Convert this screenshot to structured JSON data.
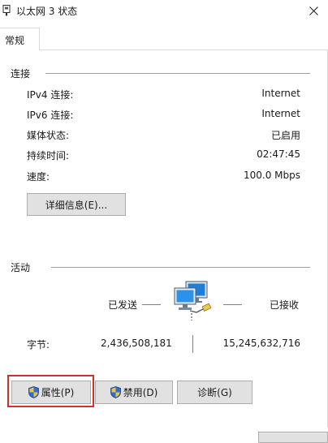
{
  "window": {
    "title": "以太网 3 状态"
  },
  "tabs": [
    {
      "label": "常规"
    }
  ],
  "connection": {
    "section_label": "连接",
    "rows": [
      {
        "label": "IPv4 连接:",
        "value": "Internet"
      },
      {
        "label": "IPv6 连接:",
        "value": "Internet"
      },
      {
        "label": "媒体状态:",
        "value": "已启用"
      },
      {
        "label": "持续时间:",
        "value": "02:47:45"
      },
      {
        "label": "速度:",
        "value": "100.0 Mbps"
      }
    ],
    "details_button": "详细信息(E)..."
  },
  "activity": {
    "section_label": "活动",
    "sent_label": "已发送",
    "received_label": "已接收",
    "bytes_label": "字节:",
    "bytes_sent": "2,436,508,181",
    "bytes_received": "15,245,632,716"
  },
  "buttons": {
    "properties": "属性(P)",
    "disable": "禁用(D)",
    "diagnose": "诊断(G)"
  },
  "colors": {
    "highlight": "#d32f2f",
    "button_bg": "#e1e1e1"
  }
}
